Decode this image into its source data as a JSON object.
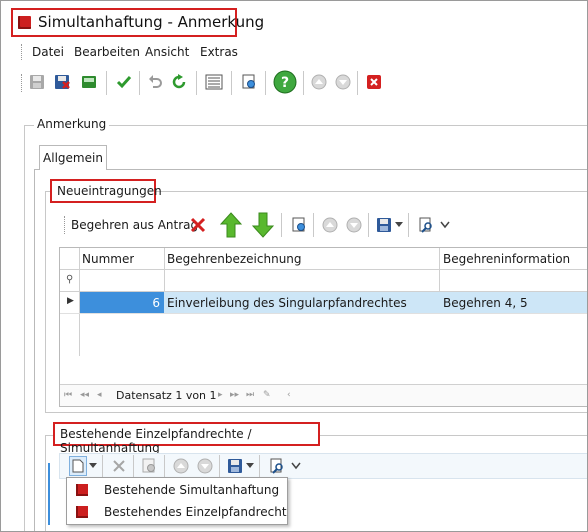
{
  "window": {
    "title": "Simultanhaftung - Anmerkung"
  },
  "menu": {
    "items": [
      "Datei",
      "Bearbeiten",
      "Ansicht",
      "Extras"
    ]
  },
  "toolbar": {
    "icons": [
      "save-icon",
      "save-close-icon",
      "save-as-icon",
      "check-icon",
      "undo-icon",
      "refresh-icon",
      "document-list-icon",
      "preview-icon",
      "help-icon",
      "move-up-icon",
      "move-down-icon",
      "close-icon"
    ]
  },
  "group": {
    "label": "Anmerkung"
  },
  "tabs": [
    {
      "label": "Allgemein",
      "active": true
    }
  ],
  "neueintragungen": {
    "title": "Neueintragungen",
    "toolbar_label": "Begehren aus Antrag",
    "grid": {
      "columns": [
        "Nummer",
        "Begehrenbezeichnung",
        "Begehreninformation"
      ],
      "rows": [
        {
          "nummer": "6",
          "bezeichnung": "Einverleibung des Singularpfandrechtes",
          "information": "Begehren 4, 5"
        }
      ],
      "navigator": "Datensatz 1 von 1"
    }
  },
  "bestehende": {
    "title": "Bestehende Einzelpfandrechte / Simultanhaftung",
    "dropdown": [
      "Bestehende Simultanhaftung",
      "Bestehendes Einzelpfandrecht"
    ]
  },
  "colors": {
    "highlight_border": "#d42020",
    "selection": "#3d8fdc",
    "row_selection": "#cde6f7",
    "brand_red": "#cc1f1f"
  }
}
